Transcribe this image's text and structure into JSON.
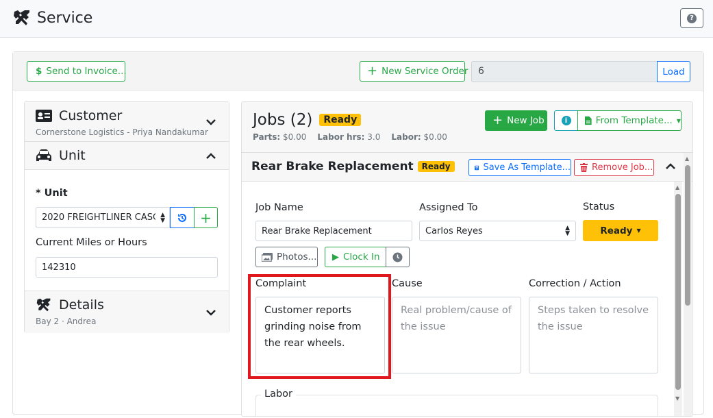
{
  "app": {
    "title": "Service",
    "help_icon": "?"
  },
  "toolbar": {
    "send_invoice": "Send to Invoice...",
    "new_service_order": "New Service Order",
    "service_order_value": "6",
    "load": "Load"
  },
  "customer": {
    "title": "Customer",
    "subtitle": "Cornerstone Logistics - Priya Nandakumar"
  },
  "unit": {
    "title": "Unit",
    "unit_label": "* Unit",
    "unit_value": "2020 FREIGHTLINER CASC",
    "miles_label": "Current Miles or Hours",
    "miles_value": "142310"
  },
  "details": {
    "title": "Details",
    "subtitle": "Bay 2 · Andrea"
  },
  "jobs": {
    "title": "Jobs (2)",
    "status_badge": "Ready",
    "parts_label": "Parts:",
    "parts_value": "$0.00",
    "labor_hrs_label": "Labor hrs:",
    "labor_hrs_value": "3.0",
    "labor_label": "Labor:",
    "labor_value": "$0.00",
    "new_job": "New Job",
    "from_template": "From Template..."
  },
  "job": {
    "title": "Rear Brake Replacement",
    "badge": "Ready",
    "save_template": "Save As Template...",
    "remove_job": "Remove Job...",
    "job_name_label": "Job Name",
    "job_name_value": "Rear Brake Replacement",
    "assigned_label": "Assigned To",
    "assigned_value": "Carlos Reyes",
    "status_label": "Status",
    "status_value": "Ready",
    "photos": "Photos...",
    "clock_in": "Clock In",
    "complaint_label": "Complaint",
    "complaint_value": "Customer reports grinding noise from the rear wheels.",
    "cause_label": "Cause",
    "cause_placeholder": "Real problem/cause of the issue",
    "correction_label": "Correction / Action",
    "correction_placeholder": "Steps taken to resolve the issue",
    "labor_label": "Labor"
  },
  "colors": {
    "accent_green": "#28a745",
    "accent_blue": "#0d6efd",
    "ready_yellow": "#ffc107",
    "highlight_red": "#e0181e"
  }
}
